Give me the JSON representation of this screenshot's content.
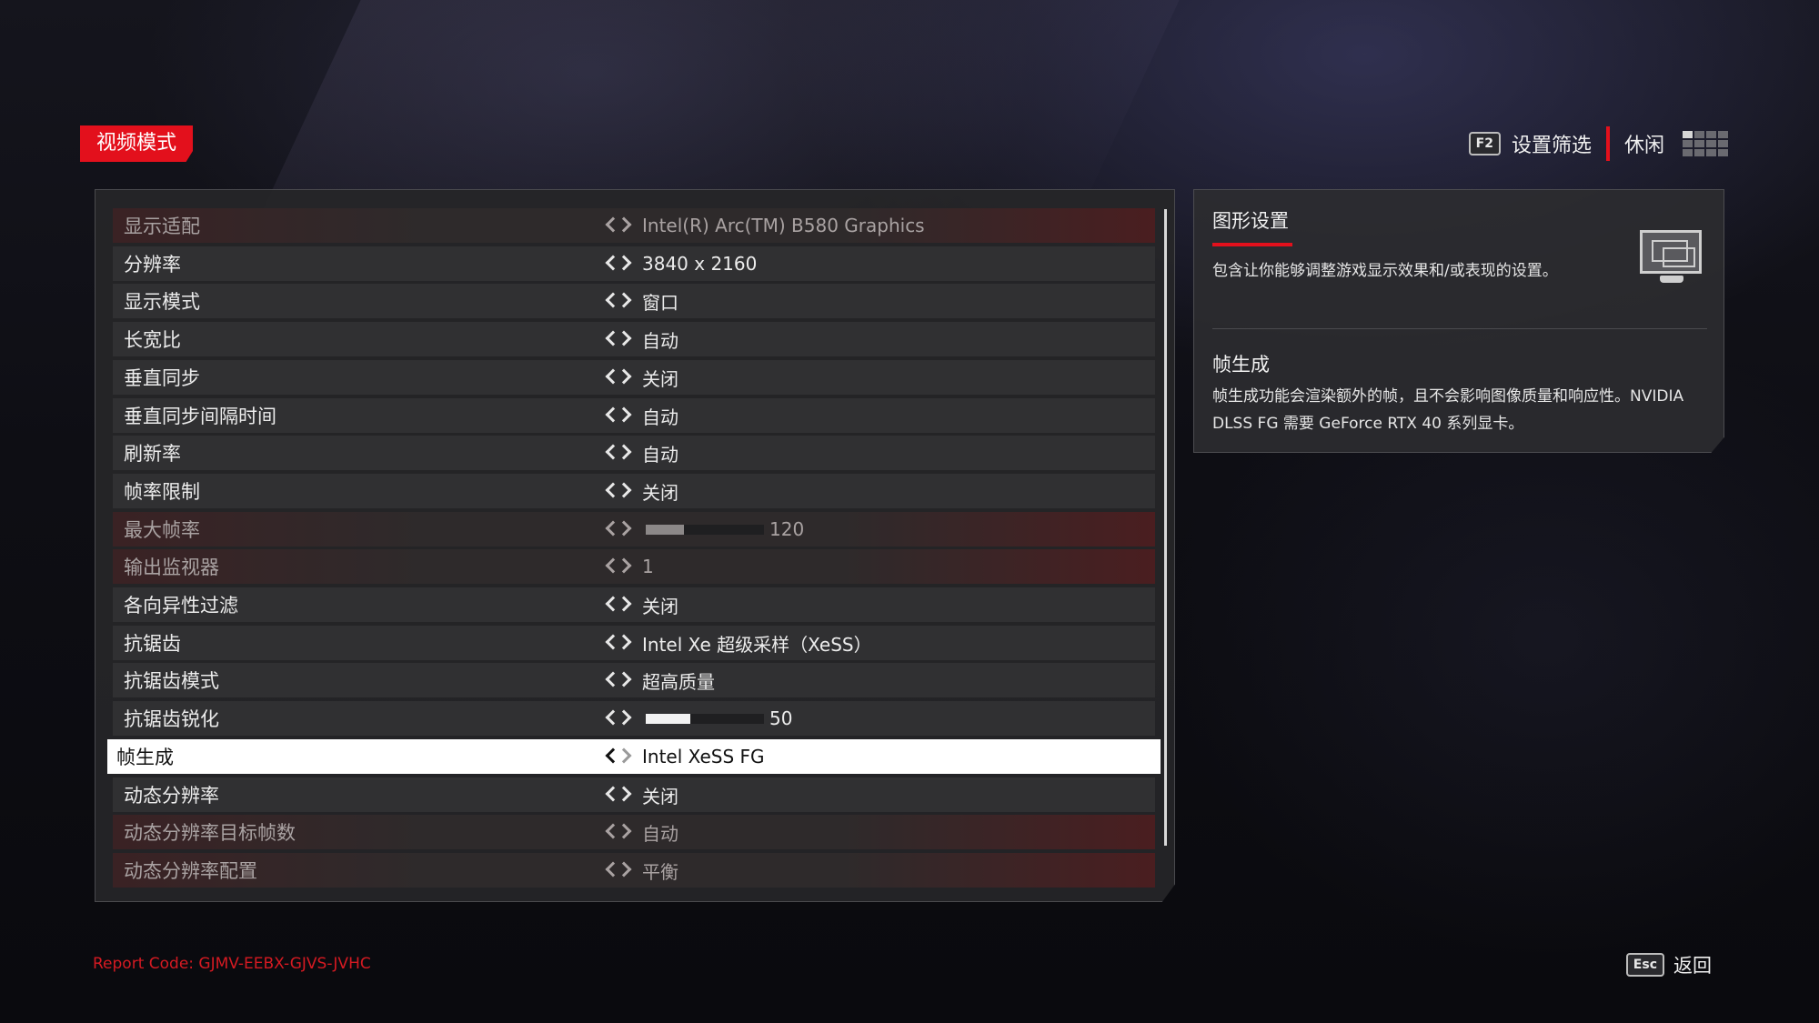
{
  "header": {
    "mode_tag": "视频模式",
    "filter_key": "F2",
    "filter_label": "设置筛选",
    "preset_label": "休闲"
  },
  "settings": [
    {
      "label": "显示适配",
      "value": "Intel(R) Arc(TM) B580 Graphics",
      "state": "dim"
    },
    {
      "label": "分辨率",
      "value": "3840 x 2160",
      "state": "normal"
    },
    {
      "label": "显示模式",
      "value": "窗口",
      "state": "normal"
    },
    {
      "label": "长宽比",
      "value": "自动",
      "state": "normal"
    },
    {
      "label": "垂直同步",
      "value": "关闭",
      "state": "normal"
    },
    {
      "label": "垂直同步间隔时间",
      "value": "自动",
      "state": "normal"
    },
    {
      "label": "刷新率",
      "value": "自动",
      "state": "normal"
    },
    {
      "label": "帧率限制",
      "value": "关闭",
      "state": "normal"
    },
    {
      "label": "最大帧率",
      "value": "120",
      "slider_fraction": 0.32,
      "state": "dim"
    },
    {
      "label": "输出监视器",
      "value": "1",
      "state": "dim"
    },
    {
      "label": "各向异性过滤",
      "value": "关闭",
      "state": "normal"
    },
    {
      "label": "抗锯齿",
      "value": "Intel Xe 超级采样（XeSS）",
      "state": "normal"
    },
    {
      "label": "抗锯齿模式",
      "value": "超高质量",
      "state": "normal"
    },
    {
      "label": "抗锯齿锐化",
      "value": "50",
      "slider_fraction": 0.38,
      "state": "normal"
    },
    {
      "label": "帧生成",
      "value": "Intel XeSS FG",
      "state": "selected"
    },
    {
      "label": "动态分辨率",
      "value": "关闭",
      "state": "normal"
    },
    {
      "label": "动态分辨率目标帧数",
      "value": "自动",
      "state": "dim"
    },
    {
      "label": "动态分辨率配置",
      "value": "平衡",
      "state": "dim"
    }
  ],
  "info": {
    "title": "图形设置",
    "description": "包含让你能够调整游戏显示效果和/或表现的设置。",
    "sub_title": "帧生成",
    "sub_description": "帧生成功能会渲染额外的帧，且不会影响图像质量和响应性。NVIDIA DLSS FG 需要 GeForce RTX 40 系列显卡。"
  },
  "footer": {
    "report_code": "Report Code: GJMV-EEBX-GJVS-JVHC",
    "back_key": "Esc",
    "back_label": "返回"
  },
  "colors": {
    "accent_red": "#e3101c",
    "row_bg": "#303032",
    "selected_bg": "#ffffff"
  }
}
